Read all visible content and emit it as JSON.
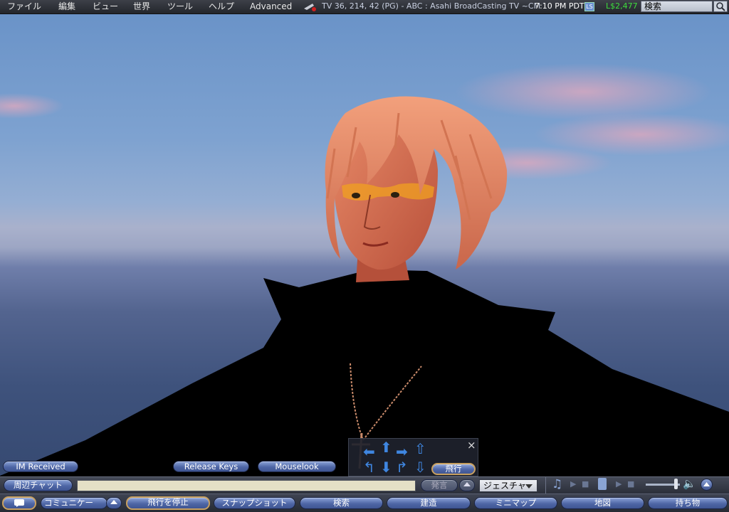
{
  "menubar": {
    "items": [
      "ファイル",
      "編集",
      "ビュー",
      "世界",
      "ツール",
      "ヘルプ",
      "Advanced"
    ],
    "location": "TV 36, 214, 42 (PG) - ABC : Asahi BroadCasting TV ~CM",
    "time": "7:10 PM PDT",
    "balance": "L$2,477",
    "search_placeholder": "検索"
  },
  "overlay_buttons": {
    "im_received": "IM Received",
    "release_keys": "Release Keys",
    "mouselook": "Mouselook"
  },
  "movement_panel": {
    "fly_label": "飛行",
    "close": "×"
  },
  "chatbar": {
    "channel": "周辺チャット",
    "input_value": "",
    "say": "発言",
    "gesture": "ジェスチャ"
  },
  "toolbar": {
    "communicate": "コミュニケー",
    "stop_flying": "飛行を停止",
    "snapshot": "スナップショット",
    "search": "検索",
    "build": "建造",
    "minimap": "ミニマップ",
    "map": "地図",
    "inventory": "持ち物"
  },
  "colors": {
    "menubar": "#2d3038",
    "balance": "#3ddc3d",
    "location": "#c8cfe0",
    "accent_blue": "#4e66a6"
  },
  "icons": {
    "teleport": "location-icon",
    "media": "music-note-icon",
    "volume": "speaker-icon"
  }
}
